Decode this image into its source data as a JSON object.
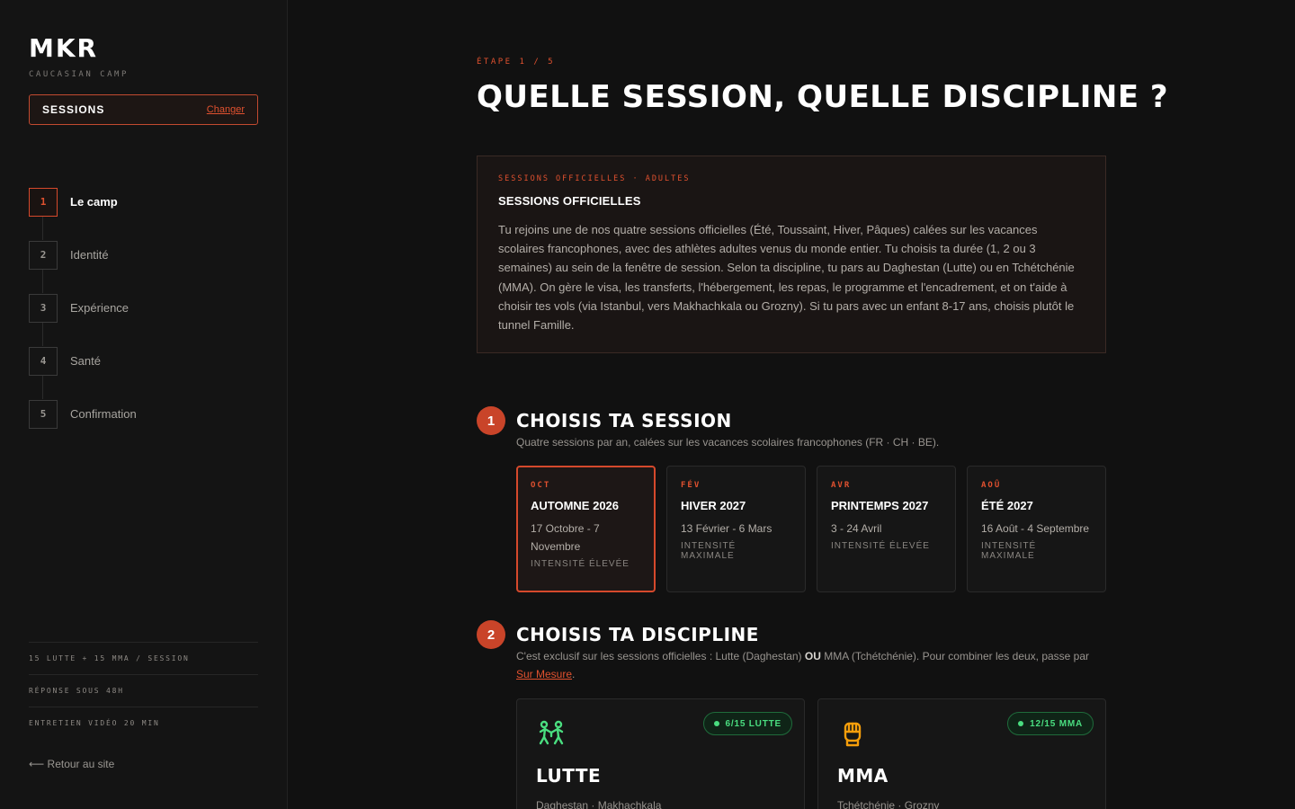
{
  "brand": {
    "logo": "MKR",
    "subtitle": "CAUCASIAN CAMP"
  },
  "session_selector": {
    "label": "SESSIONS",
    "change_label": "Changer"
  },
  "steps": [
    {
      "num": "1",
      "label": "Le camp",
      "active": true
    },
    {
      "num": "2",
      "label": "Identité"
    },
    {
      "num": "3",
      "label": "Expérience"
    },
    {
      "num": "4",
      "label": "Santé"
    },
    {
      "num": "5",
      "label": "Confirmation"
    }
  ],
  "side_facts": [
    "15 LUTTE + 15 MMA / SESSION",
    "RÉPONSE SOUS 48H",
    "ENTRETIEN VIDÉO 20 MIN"
  ],
  "back_link": "⟵ Retour au site",
  "header": {
    "eyebrow": "ÉTAPE 1 / 5",
    "title": "QUELLE SESSION, QUELLE DISCIPLINE ?"
  },
  "info": {
    "eyebrow": "SESSIONS OFFICIELLES · ADULTES",
    "title": "SESSIONS OFFICIELLES",
    "text": "Tu rejoins une de nos quatre sessions officielles (Été, Toussaint, Hiver, Pâques) calées sur les vacances scolaires francophones, avec des athlètes adultes venus du monde entier. Tu choisis ta durée (1, 2 ou 3 semaines) au sein de la fenêtre de session. Selon ta discipline, tu pars au Daghestan (Lutte) ou en Tchétchénie (MMA). On gère le visa, les transferts, l'hébergement, les repas, le programme et l'encadrement, et on t'aide à choisir tes vols (via Istanbul, vers Makhachkala ou Grozny). Si tu pars avec un enfant 8-17 ans, choisis plutôt le tunnel Famille."
  },
  "section_session": {
    "number": "1",
    "title": "CHOISIS TA SESSION",
    "desc": "Quatre sessions par an, calées sur les vacances scolaires francophones (FR · CH · BE).",
    "cards": [
      {
        "month": "OCT",
        "name": "AUTOMNE 2026",
        "dates": "17 Octobre - 7 Novembre",
        "intensity": "INTENSITÉ ÉLEVÉE",
        "selected": true
      },
      {
        "month": "FÉV",
        "name": "HIVER 2027",
        "dates": "13 Février - 6 Mars",
        "intensity": "INTENSITÉ MAXIMALE"
      },
      {
        "month": "AVR",
        "name": "PRINTEMPS 2027",
        "dates": "3 - 24 Avril",
        "intensity": "INTENSITÉ ÉLEVÉE"
      },
      {
        "month": "AOÛ",
        "name": "ÉTÉ 2027",
        "dates": "16 Août - 4 Septembre",
        "intensity": "INTENSITÉ MAXIMALE"
      }
    ]
  },
  "section_discipline": {
    "number": "2",
    "title": "CHOISIS TA DISCIPLINE",
    "desc_part1": "C'est exclusif sur les sessions officielles : Lutte (Daghestan) ",
    "desc_bold": "OU",
    "desc_part2": " MMA (Tchétchénie). Pour combiner les deux, passe par ",
    "desc_link": "Sur Mesure",
    "desc_end": ".",
    "cards": [
      {
        "name": "LUTTE",
        "badge": "6/15 LUTTE",
        "location": "Daghestan · Makhachkala",
        "icon": "wrestling-icon",
        "icon_color": "#4ade80"
      },
      {
        "name": "MMA",
        "badge": "12/15 MMA",
        "location": "Tchétchénie · Grozny",
        "icon": "boxing-glove-icon",
        "icon_color": "#f59e0b"
      }
    ]
  },
  "colors": {
    "accent": "#e0512f",
    "available": "#4ade80",
    "background": "#111111"
  }
}
